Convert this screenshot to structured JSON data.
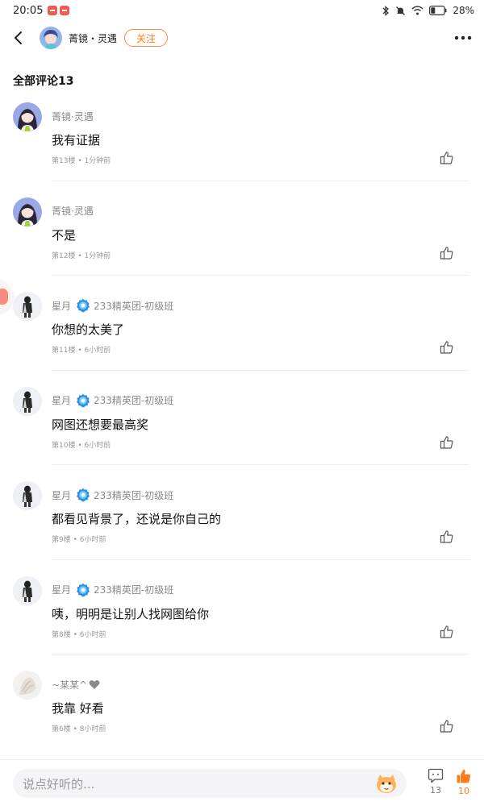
{
  "status_bar": {
    "time": "20:05",
    "battery": "28%"
  },
  "header": {
    "author_name": "菁镜・灵遇",
    "follow_label": "关注"
  },
  "comments_heading": "全部评论13",
  "comments": [
    {
      "user": "菁镜·灵遇",
      "badge": "",
      "heart": false,
      "text": "我有证据",
      "meta": "第13楼 • 1分钟前",
      "avatar": "avatar-anime-girl"
    },
    {
      "user": "菁镜·灵遇",
      "badge": "",
      "heart": false,
      "text": "不是",
      "meta": "第12楼 • 1分钟前",
      "avatar": "avatar-anime-girl"
    },
    {
      "user": "星月",
      "badge": "233精英团-初级班",
      "heart": false,
      "text": "你想的太美了",
      "meta": "第11楼 • 6小时前",
      "avatar": "avatar-figure"
    },
    {
      "user": "星月",
      "badge": "233精英团-初级班",
      "heart": false,
      "text": "网图还想要最高奖",
      "meta": "第10楼 • 6小时前",
      "avatar": "avatar-figure"
    },
    {
      "user": "星月",
      "badge": "233精英团-初级班",
      "heart": false,
      "text": "都看见背景了，还说是你自己的",
      "meta": "第9楼 • 6小时前",
      "avatar": "avatar-figure"
    },
    {
      "user": "星月",
      "badge": "233精英团-初级班",
      "heart": false,
      "text": "咦，明明是让别人找网图给你",
      "meta": "第8楼 • 6小时前",
      "avatar": "avatar-figure"
    },
    {
      "user": "~某某^",
      "badge": "",
      "heart": true,
      "text": "我靠 好看",
      "meta": "第6楼 • 8小时前",
      "avatar": "avatar-sketch"
    }
  ],
  "bottom_bar": {
    "input_placeholder": "说点好听的...",
    "comment_count": "13",
    "like_count": "10"
  },
  "colors": {
    "accent": "#ff7a1a",
    "muted_text": "#8a8a8a",
    "badge_blue": "#2f8fe6"
  },
  "icons": [
    "back-icon",
    "more-icon",
    "like-icon",
    "verified-badge-icon",
    "heart-icon",
    "comment-icon",
    "thumbs-up-filled-icon",
    "mascot-icon"
  ]
}
